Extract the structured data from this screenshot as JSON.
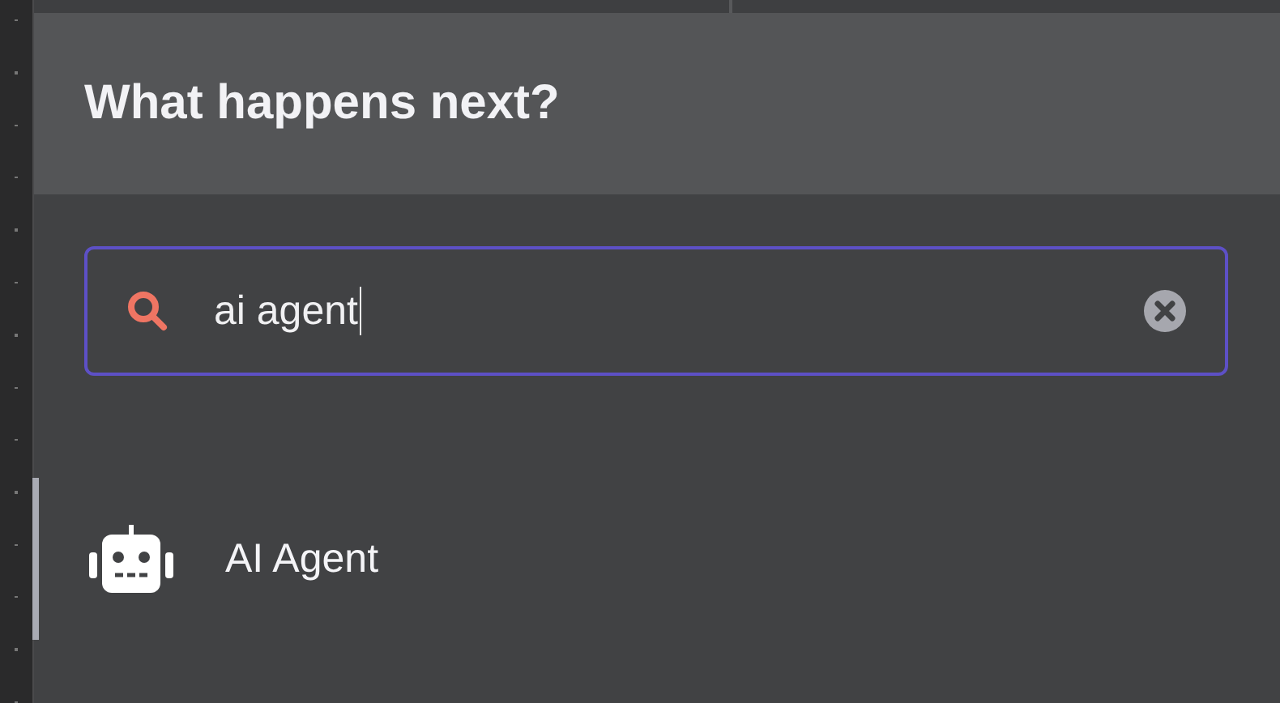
{
  "panel": {
    "title": "What happens next?"
  },
  "search": {
    "value": "ai agent"
  },
  "results": [
    {
      "label": "AI Agent",
      "selected": true
    }
  ]
}
